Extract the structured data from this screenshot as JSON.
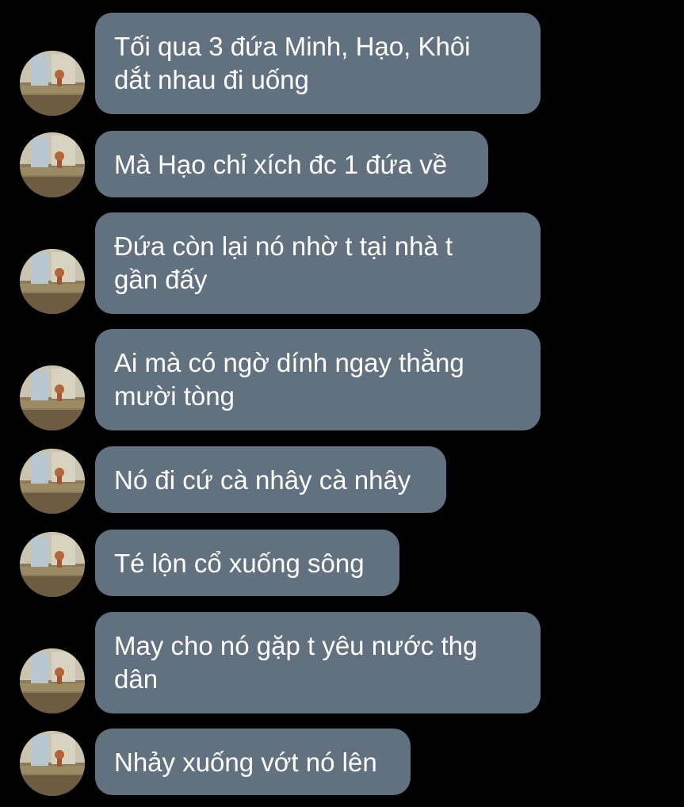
{
  "colors": {
    "background": "#000000",
    "bubble": "#627180",
    "text": "#ffffff"
  },
  "messages": [
    {
      "text": "Tối qua 3 đứa Minh, Hạo, Khôi\ndắt nhau đi uống",
      "avatar": "contact-avatar"
    },
    {
      "text": "Mà Hạo chỉ xích đc 1 đứa về",
      "avatar": "contact-avatar"
    },
    {
      "text": "Đứa còn lại nó nhờ t tại nhà t\ngần đấy",
      "avatar": "contact-avatar"
    },
    {
      "text": "Ai mà có ngờ dính ngay thằng\nmười tòng",
      "avatar": "contact-avatar"
    },
    {
      "text": "Nó đi cứ cà nhây cà nhây",
      "avatar": "contact-avatar"
    },
    {
      "text": "Té lộn cổ xuống sông",
      "avatar": "contact-avatar"
    },
    {
      "text": "May cho nó gặp t yêu nước thg\ndân",
      "avatar": "contact-avatar"
    },
    {
      "text": "Nhảy xuống vớt nó lên",
      "avatar": "contact-avatar"
    }
  ]
}
